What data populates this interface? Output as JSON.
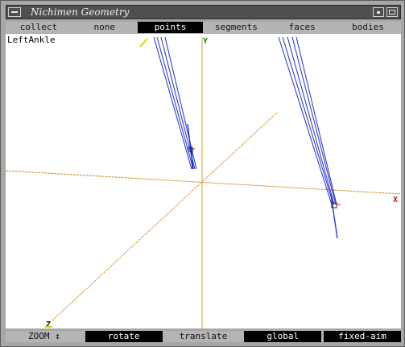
{
  "window": {
    "title": "Nichimen Geometry"
  },
  "top_tabs": [
    {
      "label": "collect",
      "active": false
    },
    {
      "label": "none",
      "active": false
    },
    {
      "label": "points",
      "active": true
    },
    {
      "label": "segments",
      "active": false
    },
    {
      "label": "faces",
      "active": false
    },
    {
      "label": "bodies",
      "active": false
    }
  ],
  "viewport": {
    "selected_point": "LeftAnkle",
    "axes": {
      "x": "X",
      "y": "Y",
      "z": "Z"
    }
  },
  "bottom_tabs": [
    {
      "label": "ZOOM ↕",
      "active": false
    },
    {
      "label": "rotate",
      "active": true
    },
    {
      "label": "translate",
      "active": false
    },
    {
      "label": "global",
      "active": true
    },
    {
      "label": "fixed-aim",
      "active": true
    }
  ],
  "colors": {
    "axis": "#d68a2a",
    "vertical_axis": "#d4a040",
    "segments": "#1f2fd0",
    "point_marker": "#d01010",
    "active_tab": "#000000",
    "background": "#ffffff"
  }
}
